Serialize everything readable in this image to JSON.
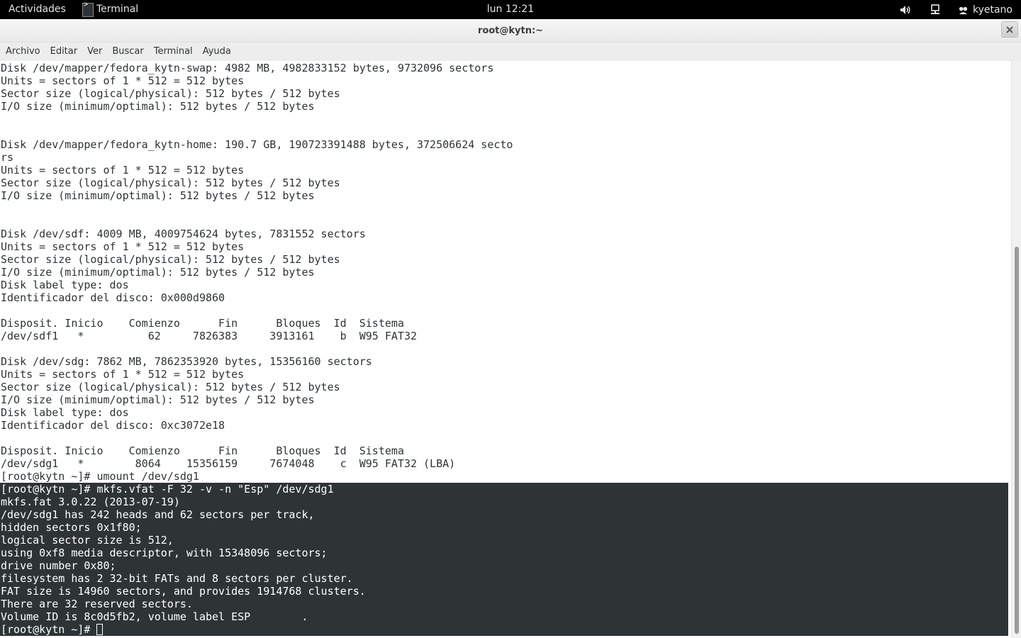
{
  "topbar": {
    "activities": "Actividades",
    "app_name": "Terminal",
    "clock": "lun 12:21",
    "user": "kyetano",
    "icons": {
      "volume": "speaker-icon",
      "network": "wired-network-icon",
      "user": "user-icon"
    }
  },
  "window": {
    "title": "root@kytn:~",
    "close_icon": "close-icon"
  },
  "menu": {
    "items": [
      "Archivo",
      "Editar",
      "Ver",
      "Buscar",
      "Terminal",
      "Ayuda"
    ]
  },
  "terminal": {
    "lines": [
      "Disk /dev/mapper/fedora_kytn-swap: 4982 MB, 4982833152 bytes, 9732096 sectors",
      "Units = sectors of 1 * 512 = 512 bytes",
      "Sector size (logical/physical): 512 bytes / 512 bytes",
      "I/O size (minimum/optimal): 512 bytes / 512 bytes",
      "",
      "",
      "Disk /dev/mapper/fedora_kytn-home: 190.7 GB, 190723391488 bytes, 372506624 secto",
      "rs",
      "Units = sectors of 1 * 512 = 512 bytes",
      "Sector size (logical/physical): 512 bytes / 512 bytes",
      "I/O size (minimum/optimal): 512 bytes / 512 bytes",
      "",
      "",
      "Disk /dev/sdf: 4009 MB, 4009754624 bytes, 7831552 sectors",
      "Units = sectors of 1 * 512 = 512 bytes",
      "Sector size (logical/physical): 512 bytes / 512 bytes",
      "I/O size (minimum/optimal): 512 bytes / 512 bytes",
      "Disk label type: dos",
      "Identificador del disco: 0x000d9860",
      "",
      "Disposit. Inicio    Comienzo      Fin      Bloques  Id  Sistema",
      "/dev/sdf1   *          62     7826383     3913161    b  W95 FAT32",
      "",
      "Disk /dev/sdg: 7862 MB, 7862353920 bytes, 15356160 sectors",
      "Units = sectors of 1 * 512 = 512 bytes",
      "Sector size (logical/physical): 512 bytes / 512 bytes",
      "I/O size (minimum/optimal): 512 bytes / 512 bytes",
      "Disk label type: dos",
      "Identificador del disco: 0xc3072e18",
      "",
      "Disposit. Inicio    Comienzo      Fin      Bloques  Id  Sistema",
      "/dev/sdg1   *        8064    15356159     7674048    c  W95 FAT32 (LBA)",
      "[root@kytn ~]# umount /dev/sdg1"
    ],
    "selected_lines": [
      "[root@kytn ~]# mkfs.vfat -F 32 -v -n \"Esp\" /dev/sdg1",
      "mkfs.fat 3.0.22 (2013-07-19)",
      "/dev/sdg1 has 242 heads and 62 sectors per track,",
      "hidden sectors 0x1f80;",
      "logical sector size is 512,",
      "using 0xf8 media descriptor, with 15348096 sectors;",
      "drive number 0x80;",
      "filesystem has 2 32-bit FATs and 8 sectors per cluster.",
      "FAT size is 14960 sectors, and provides 1914768 clusters.",
      "There are 32 reserved sectors.",
      "Volume ID is 8c0d5fb2, volume label ESP        ."
    ],
    "prompt": "[root@kytn ~]# "
  },
  "colors": {
    "topbar_bg": "#000000",
    "terminal_bg": "#ffffff",
    "terminal_fg": "#2e3436",
    "selection_bg": "#2e3436",
    "selection_fg": "#ffffff"
  }
}
